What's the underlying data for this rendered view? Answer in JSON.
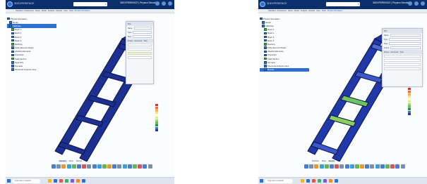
{
  "screens": [
    {
      "app": {
        "brand": "3DEXPERIENCE",
        "search_placeholder": "Search",
        "title": "3DEXPERIENCE | Physics Simulation"
      },
      "menu": [
        "Standard",
        "Parameters",
        "Setup",
        "Model",
        "Analysis",
        "Results",
        "View",
        "Tools",
        "Physics Simulation"
      ],
      "tree": [
        {
          "label": "Physics Simulation",
          "icon": "simulation-icon",
          "selected": false
        },
        {
          "label": "Model",
          "icon": "model-icon",
          "selected": false
        },
        {
          "label": "FEM Rep",
          "icon": "fem-icon",
          "selected": true
        },
        {
          "label": "Mesh 1",
          "icon": "mesh-icon",
          "selected": false
        },
        {
          "label": "Mesh 2",
          "icon": "mesh-icon",
          "selected": false
        },
        {
          "label": "Mesh 3",
          "icon": "mesh-icon",
          "selected": false
        },
        {
          "label": "Mesh 4",
          "icon": "mesh-icon",
          "selected": false
        },
        {
          "label": "Meshing",
          "icon": "mesh-icon",
          "selected": false
        },
        {
          "label": "Finite Element Model",
          "icon": "fem-icon",
          "selected": false
        },
        {
          "label": "Abstract Elements",
          "icon": "elements-icon",
          "selected": false
        },
        {
          "label": "Properties",
          "icon": "properties-icon",
          "selected": false
        },
        {
          "label": "Solid Section",
          "icon": "section-icon",
          "selected": false
        },
        {
          "label": "Assembly",
          "icon": "assembly-icon",
          "selected": false
        },
        {
          "label": "Scenario",
          "icon": "scenario-icon",
          "selected": false
        },
        {
          "label": "Structural Analysis Case",
          "icon": "analysis-icon",
          "selected": false
        }
      ],
      "panel": {
        "title": "Plot",
        "rows": [
          [
            "Name",
            "Plot"
          ],
          [
            "Type",
            ""
          ],
          [
            "Step",
            ""
          ]
        ],
        "table_header": [
          "Frame",
          "Increment",
          "Time"
        ],
        "table_rows": [
          [
            "",
            "",
            ""
          ],
          [
            "",
            "",
            ""
          ],
          [
            "",
            "",
            ""
          ],
          [
            "",
            "",
            ""
          ]
        ]
      },
      "legend": {
        "title": "",
        "colors": [
          "#d73027",
          "#f46d43",
          "#fdae61",
          "#fee08b",
          "#ffffbf",
          "#d9ef8b",
          "#a6d96a",
          "#66bd63",
          "#1a9850",
          "#4575b4",
          "#313695"
        ],
        "values": [
          "",
          "",
          "",
          "",
          "",
          "",
          "",
          "",
          "",
          "",
          ""
        ]
      },
      "tabs": [
        "Standard",
        "Setup",
        "Results"
      ],
      "taskbar": {
        "search": "Type here to search",
        "tray": ""
      }
    },
    {
      "app": {
        "brand": "3DEXPERIENCE",
        "search_placeholder": "Search",
        "title": "3DEXPERIENCE | Physics Simulation"
      },
      "menu": [
        "Standard",
        "Parameters",
        "Setup",
        "Model",
        "Analysis",
        "Results",
        "View",
        "Tools",
        "Physics Simulation"
      ],
      "tree": [
        {
          "label": "Physics Simulation",
          "icon": "simulation-icon",
          "selected": false
        },
        {
          "label": "Model",
          "icon": "model-icon",
          "selected": false
        },
        {
          "label": "FEM Rep",
          "icon": "fem-icon",
          "selected": false
        },
        {
          "label": "Mesh 1",
          "icon": "mesh-icon",
          "selected": false
        },
        {
          "label": "Mesh 2",
          "icon": "mesh-icon",
          "selected": false
        },
        {
          "label": "Mesh 3",
          "icon": "mesh-icon",
          "selected": false
        },
        {
          "label": "Mesh 4",
          "icon": "mesh-icon",
          "selected": false
        },
        {
          "label": "Meshing",
          "icon": "mesh-icon",
          "selected": false
        },
        {
          "label": "Finite Element Model",
          "icon": "fem-icon",
          "selected": false
        },
        {
          "label": "Abstract Elements",
          "icon": "elements-icon",
          "selected": false
        },
        {
          "label": "Properties",
          "icon": "properties-icon",
          "selected": false
        },
        {
          "label": "Solid Section",
          "icon": "section-icon",
          "selected": false
        },
        {
          "label": "Scenario",
          "icon": "scenario-icon",
          "selected": false
        },
        {
          "label": "Structural Analysis Case",
          "icon": "analysis-icon",
          "selected": false
        },
        {
          "label": "Results",
          "icon": "results-icon",
          "selected": true
        }
      ],
      "panel": {
        "title": "Plot",
        "rows": [
          [
            "Name",
            "Plot"
          ],
          [
            "Type",
            ""
          ],
          [
            "Step",
            ""
          ],
          [
            "Frame",
            ""
          ]
        ],
        "table_header": [
          "Frame",
          "Increment",
          "Time"
        ],
        "table_rows": [
          [
            "",
            "",
            ""
          ],
          [
            "",
            "",
            ""
          ],
          [
            "",
            "",
            ""
          ],
          [
            "",
            "",
            ""
          ]
        ]
      },
      "legend": {
        "title": "",
        "colors": [
          "#d73027",
          "#f46d43",
          "#fdae61",
          "#fee08b",
          "#ffffbf",
          "#d9ef8b",
          "#a6d96a",
          "#66bd63",
          "#1a9850",
          "#4575b4",
          "#313695"
        ],
        "values": [
          "",
          "",
          "",
          "",
          "",
          "",
          "",
          "",
          "",
          "",
          ""
        ]
      },
      "tabs": [
        "Standard",
        "Setup",
        "Results"
      ],
      "taskbar": {
        "search": "Type here to search",
        "tray": ""
      }
    }
  ],
  "colors": {
    "frame": "#1d2f8f",
    "frame_edge": "#0a1550",
    "banner": "#0b2f6a",
    "accent": "#2f6fd0"
  }
}
